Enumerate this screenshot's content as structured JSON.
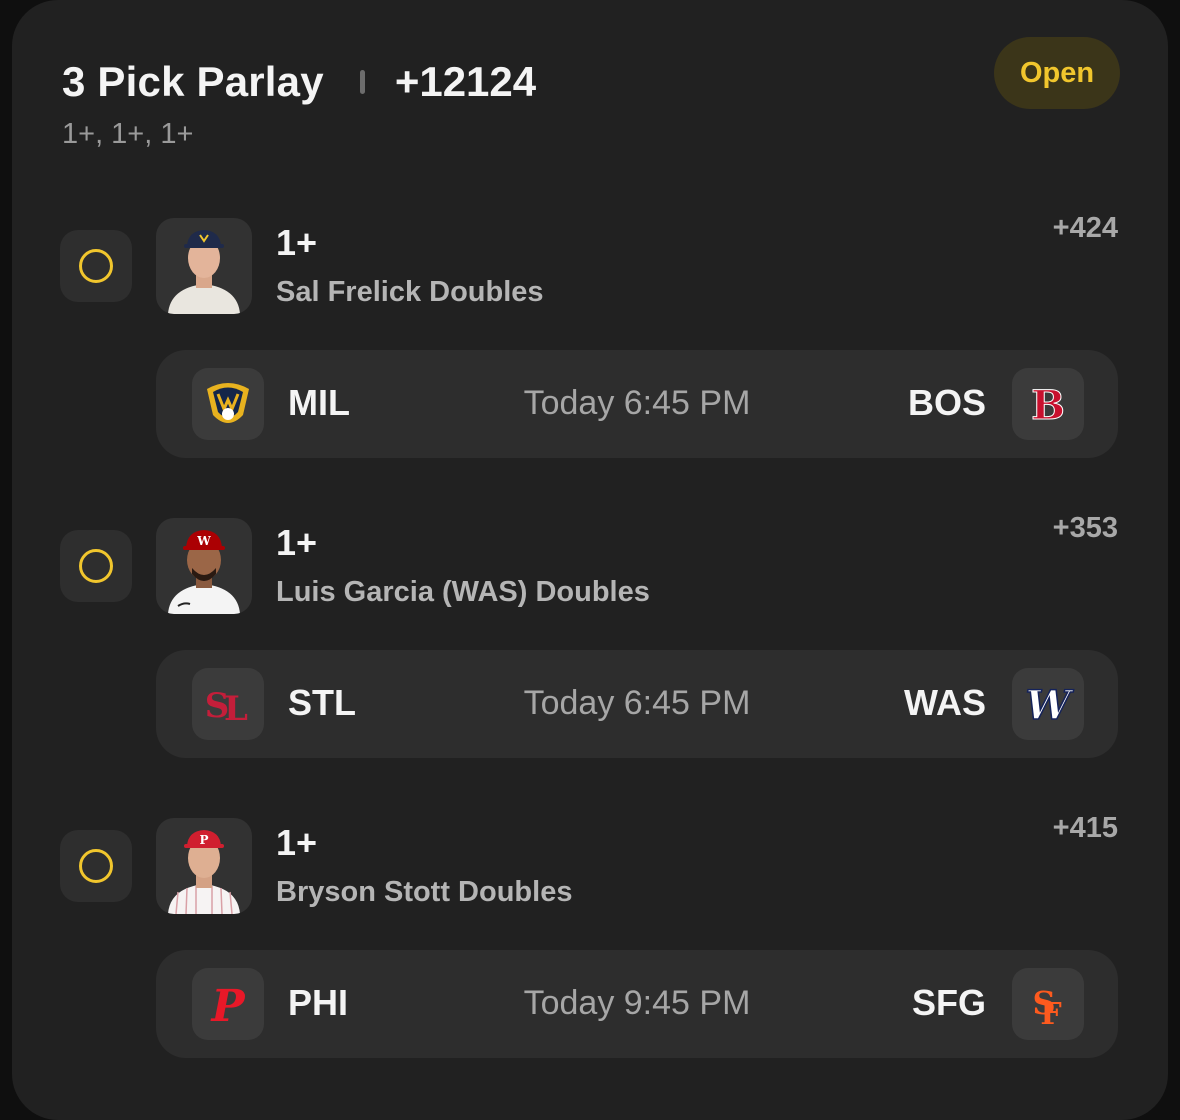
{
  "card": {
    "title": "3 Pick Parlay",
    "total_odds": "+12124",
    "subtitle": "1+, 1+, 1+",
    "status": "Open"
  },
  "colors": {
    "accent": "#f1c62d",
    "card_bg": "#212121"
  },
  "picks": [
    {
      "line": "1+",
      "market": "Sal Frelick Doubles",
      "odds": "+424",
      "player_icon": "player-headshot-brewers",
      "game": {
        "away": "MIL",
        "home": "BOS",
        "time": "Today 6:45 PM",
        "away_icon": "brewers-logo-icon",
        "home_icon": "red-sox-logo-icon"
      }
    },
    {
      "line": "1+",
      "market": "Luis Garcia (WAS) Doubles",
      "odds": "+353",
      "player_icon": "player-headshot-nationals",
      "game": {
        "away": "STL",
        "home": "WAS",
        "time": "Today 6:45 PM",
        "away_icon": "cardinals-logo-icon",
        "home_icon": "nationals-logo-icon"
      }
    },
    {
      "line": "1+",
      "market": "Bryson Stott Doubles",
      "odds": "+415",
      "player_icon": "player-headshot-phillies",
      "game": {
        "away": "PHI",
        "home": "SFG",
        "time": "Today 9:45 PM",
        "away_icon": "phillies-logo-icon",
        "home_icon": "giants-logo-icon"
      }
    }
  ]
}
